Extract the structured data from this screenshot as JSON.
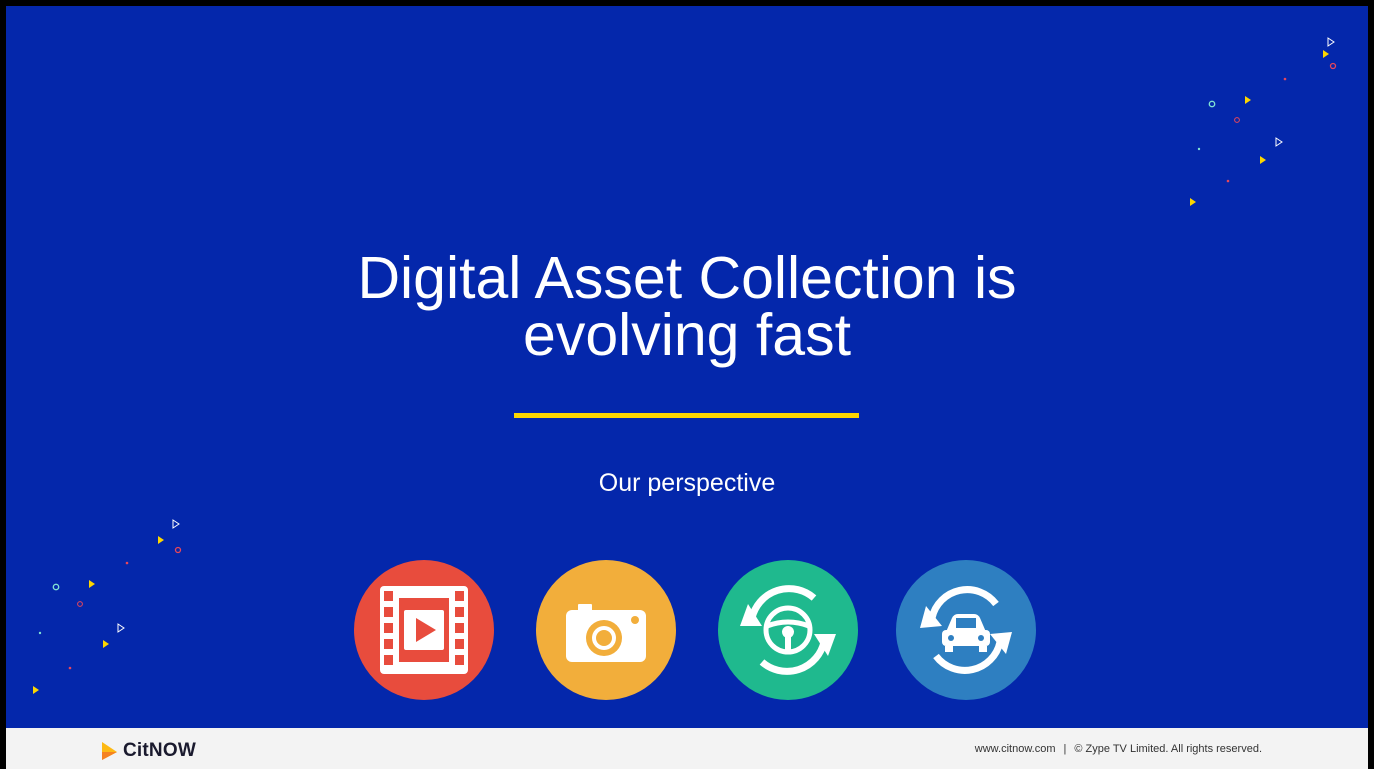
{
  "slide": {
    "title_line1": "Digital Asset Collection is",
    "title_line2": "evolving fast",
    "subtitle": "Our perspective"
  },
  "icons": [
    {
      "name": "video-icon",
      "color": "#e84c3d"
    },
    {
      "name": "camera-icon",
      "color": "#f2ae3b"
    },
    {
      "name": "steering-wheel-icon",
      "color": "#1fb98e"
    },
    {
      "name": "car-exchange-icon",
      "color": "#2e7fc1"
    }
  ],
  "footer": {
    "brand": "CitNOW",
    "website": "www.citnow.com",
    "separator": "|",
    "copyright": "© Zype TV Limited. All rights reserved."
  },
  "colors": {
    "background": "#0427ab",
    "accent": "#fdd600",
    "footer_bg": "#f3f3f3"
  }
}
